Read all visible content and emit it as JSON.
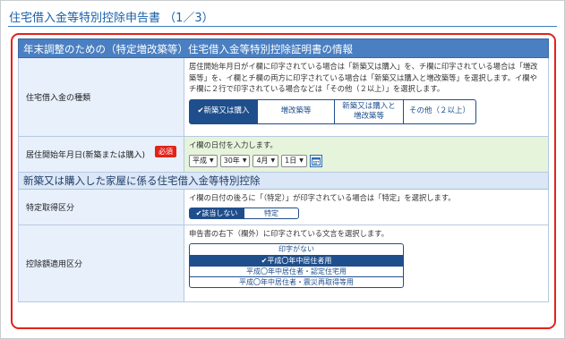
{
  "page": {
    "title": "住宅借入金等特別控除申告書 （1／3）"
  },
  "section1": {
    "heading": "年末調整のための（特定増改築等）住宅借入金等特別控除証明書の情報",
    "loan_type": {
      "label": "住宅借入金の種類",
      "note": "居住開始年月日がイ欄に印字されている場合は「新築又は購入」を、チ欄に印字されている場合は「増改築等」を、イ欄とチ欄の両方に印字されている場合は「新築又は購入と増改築等」を選択します。イ欄やチ欄に２行で印字されている場合などは「その他（２以上）」を選択します。",
      "options": [
        "✔新築又は購入",
        "増改築等",
        "新築又は購入と増改築等",
        "その他（２以上）"
      ],
      "selected": 0
    },
    "start_date": {
      "label": "居住開始年月日(新築または購入)",
      "required_badge": "必須",
      "note": "イ欄の日付を入力します。",
      "era": "平成",
      "year": "30年",
      "month": "4月",
      "day": "1日"
    }
  },
  "section2": {
    "heading": "新築又は購入した家屋に係る住宅借入金等特別控除",
    "specified": {
      "label": "特定取得区分",
      "note": "イ欄の日付の後ろに「（特定）」が印字されている場合は「特定」を選択します。",
      "options": [
        "✔該当しない",
        "特定"
      ],
      "selected": 0
    },
    "deduction": {
      "label": "控除額適用区分",
      "note": "申告書の右下（欄外）に印字されている文言を選択します。",
      "options": [
        "印字がない",
        "✔平成〇年中居住者用",
        "平成〇年中居住者・認定住宅用",
        "平成〇年中居住者・震災再取得等用"
      ],
      "selected": 1
    }
  }
}
